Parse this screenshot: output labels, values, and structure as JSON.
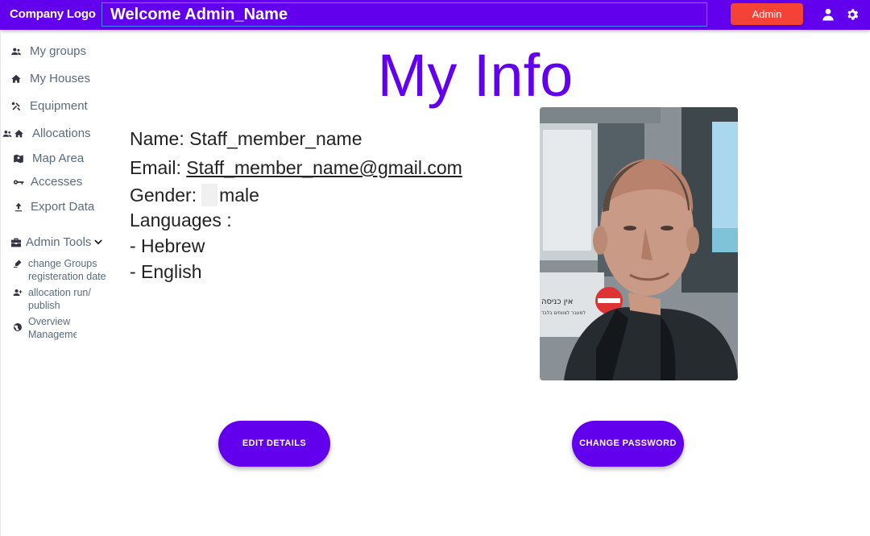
{
  "header": {
    "logo": "Company Logo",
    "welcome": "Welcome Admin_Name",
    "admin_button": "Admin"
  },
  "sidebar": {
    "items": [
      {
        "label": "My groups",
        "icon": "group-icon"
      },
      {
        "label": "My Houses",
        "icon": "home-icon"
      },
      {
        "label": "Equipment",
        "icon": "tools-icon"
      },
      {
        "label": "Allocations",
        "icon": "group-home-icon"
      },
      {
        "label": "Map Area",
        "icon": "map-icon"
      },
      {
        "label": "Accesses",
        "icon": "key-icon"
      },
      {
        "label": "Export Data",
        "icon": "upload-icon"
      }
    ],
    "admin_tools": {
      "label": "Admin Tools",
      "items": [
        {
          "label": "change Groups registeration date",
          "icon": "edit-date-icon"
        },
        {
          "label": "allocation run/ publish",
          "icon": "person-add-icon"
        },
        {
          "label": "Overview Management",
          "icon": "globe-icon"
        }
      ]
    }
  },
  "main": {
    "title": "My Info",
    "name_label": "Name:",
    "name_value": "Staff_member_name",
    "email_label": "Email:",
    "email_value": "Staff_member_name@gmail.com",
    "gender_label": "Gender:",
    "gender_value": "male",
    "languages_label": "Languages :",
    "languages": [
      "- Hebrew",
      "- English"
    ],
    "photo_sign_text": "אין כניסה",
    "photo_sign_subtext": "למעבר לצוותים בלבד",
    "edit_button": "EDIT DETAILS",
    "password_button": "CHANGE PASSWORD"
  },
  "colors": {
    "primary": "#6200ee",
    "admin_button": "#f44336"
  }
}
